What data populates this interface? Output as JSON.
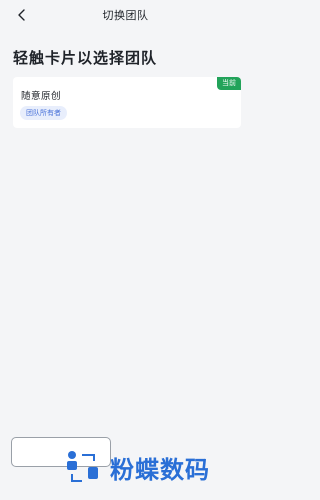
{
  "nav": {
    "title": "切换团队",
    "back_icon": "chevron-left-icon"
  },
  "page": {
    "heading": "轻触卡片以选择团队"
  },
  "teams": [
    {
      "name": "随意原创",
      "role": "团队所有者",
      "current_label": "当前"
    }
  ],
  "colors": {
    "background": "#f4f5f7",
    "current_tag": "#22a35a",
    "role_badge_bg": "#e8eefc",
    "role_badge_text": "#4a73d9",
    "watermark": "#2a6fd6"
  },
  "watermark": {
    "text": "粉蝶数码",
    "logo_icon": "watermark-logo-icon"
  }
}
